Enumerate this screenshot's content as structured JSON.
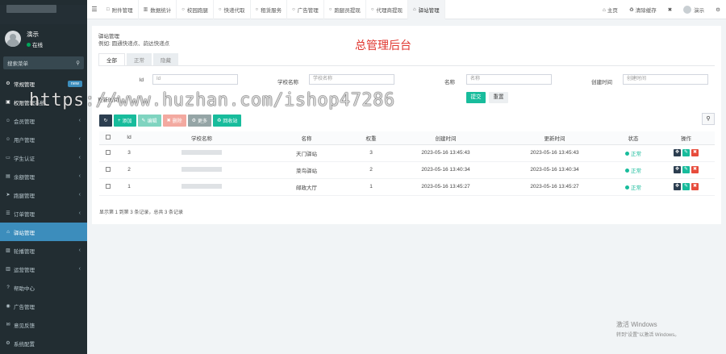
{
  "sidebar": {
    "user": {
      "name": "演示",
      "status": "在线"
    },
    "search_placeholder": "搜索菜单",
    "menu": [
      {
        "label": "常规管理",
        "icon": "gears-icon",
        "badge": "new",
        "style": "white"
      },
      {
        "label": "权限管理系统",
        "icon": "lock-icon",
        "style": "white"
      },
      {
        "label": "会员管理",
        "icon": "user-icon",
        "arrow": "‹"
      },
      {
        "label": "用户管理",
        "icon": "user-icon",
        "arrow": "‹"
      },
      {
        "label": "学生认证",
        "icon": "id-card-icon",
        "arrow": "‹"
      },
      {
        "label": "余额管理",
        "icon": "wallet-icon",
        "arrow": "‹"
      },
      {
        "label": "跑腿管理",
        "icon": "run-icon",
        "arrow": "‹"
      },
      {
        "label": "订单管理",
        "icon": "list-icon",
        "arrow": "‹"
      },
      {
        "label": "驿站管理",
        "icon": "store-icon",
        "active": true
      },
      {
        "label": "轮播管理",
        "icon": "image-icon",
        "arrow": "‹"
      },
      {
        "label": "运营管理",
        "icon": "chart-icon",
        "arrow": "‹"
      },
      {
        "label": "帮助中心",
        "icon": "help-icon"
      },
      {
        "label": "广告管理",
        "icon": "ad-icon"
      },
      {
        "label": "意见反馈",
        "icon": "comment-icon"
      },
      {
        "label": "系统配置",
        "icon": "gear-icon"
      }
    ]
  },
  "topbar": {
    "tabs": [
      {
        "label": "附件管理",
        "icon": "file-icon"
      },
      {
        "label": "数据统计",
        "icon": "chart-icon"
      },
      {
        "label": "校园跑腿",
        "icon": "circle-icon"
      },
      {
        "label": "快递代取",
        "icon": "circle-icon"
      },
      {
        "label": "租赁服务",
        "icon": "circle-icon"
      },
      {
        "label": "广告管理",
        "icon": "circle-icon"
      },
      {
        "label": "跑腿员提现",
        "icon": "circle-icon"
      },
      {
        "label": "代理商提现",
        "icon": "circle-icon"
      },
      {
        "label": "驿站管理",
        "icon": "store-icon",
        "active": true
      }
    ],
    "right": {
      "home": "主页",
      "clear_cache": "清除缓存",
      "user": "演示"
    }
  },
  "panel": {
    "title": "驿站管理",
    "tip": "例如: 圆通快递点、韵达快递点",
    "big_title": "总管理后台",
    "tabs": [
      "全部",
      "正常",
      "隐藏"
    ],
    "filters": {
      "id_label": "Id",
      "id_placeholder": "Id",
      "school_label": "学校名称",
      "school_placeholder": "学校名称",
      "name_label": "名称",
      "name_placeholder": "名称",
      "create_label": "创建时间",
      "create_placeholder": "创建时间",
      "update_label": "更新时间",
      "submit": "提交",
      "reset": "重置"
    },
    "toolbar": {
      "add": "添加",
      "edit": "编辑",
      "delete": "删除",
      "more": "更多",
      "recycle": "回收站"
    },
    "columns": [
      "Id",
      "学校名称",
      "名称",
      "权重",
      "创建时间",
      "更新时间",
      "状态",
      "操作"
    ],
    "rows": [
      {
        "id": "3",
        "name": "天门驿站",
        "weight": "3",
        "created": "2023-05-16 13:45:43",
        "updated": "2023-05-16 13:45:43",
        "status": "正常"
      },
      {
        "id": "2",
        "name": "菜鸟驿站",
        "weight": "2",
        "created": "2023-05-16 13:40:34",
        "updated": "2023-05-16 13:40:34",
        "status": "正常"
      },
      {
        "id": "1",
        "name": "邮政大厅",
        "weight": "1",
        "created": "2023-05-16 13:45:27",
        "updated": "2023-05-16 13:45:27",
        "status": "正常"
      }
    ],
    "footer": "显示第 1 到第 3 条记录，总共 3 条记录"
  },
  "watermark": "https://www.huzhan.com/ishop47286",
  "windows": {
    "line1": "激活 Windows",
    "line2": "转到\"设置\"以激活 Windows。"
  }
}
